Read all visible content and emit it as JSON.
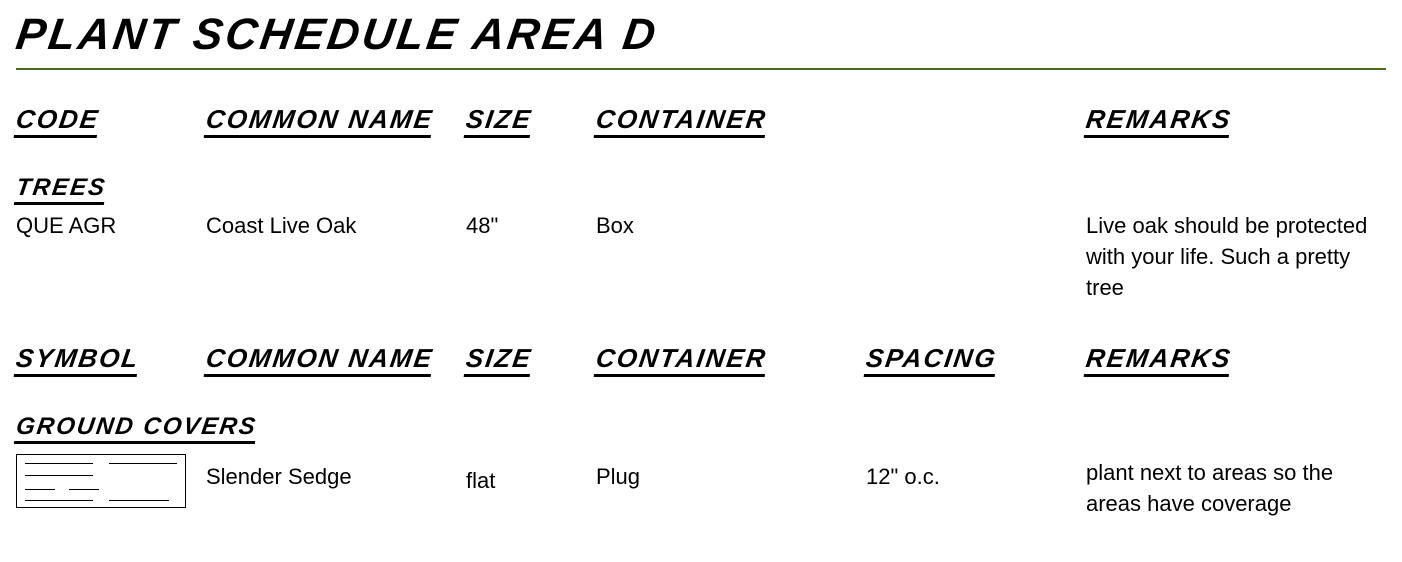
{
  "title": "PLANT SCHEDULE AREA D",
  "headers1": {
    "code": "CODE",
    "common_name": "COMMON NAME",
    "size": "SIZE",
    "container": "CONTAINER",
    "spacing": "",
    "remarks": "REMARKS"
  },
  "section1": {
    "label": "TREES",
    "row": {
      "code": "QUE AGR",
      "common_name": "Coast Live Oak",
      "size": "48\"",
      "container": "Box",
      "spacing": "",
      "remarks": "Live oak should be protected with your life. Such a pretty tree"
    }
  },
  "headers2": {
    "symbol": "SYMBOL",
    "common_name": "COMMON NAME",
    "size": "SIZE",
    "container": "CONTAINER",
    "spacing": "SPACING",
    "remarks": "REMARKS"
  },
  "section2": {
    "label": "GROUND COVERS",
    "row": {
      "common_name": "Slender Sedge",
      "size": "flat",
      "container": "Plug",
      "spacing": "12\" o.c.",
      "remarks": "plant next to areas so the areas have coverage"
    }
  }
}
